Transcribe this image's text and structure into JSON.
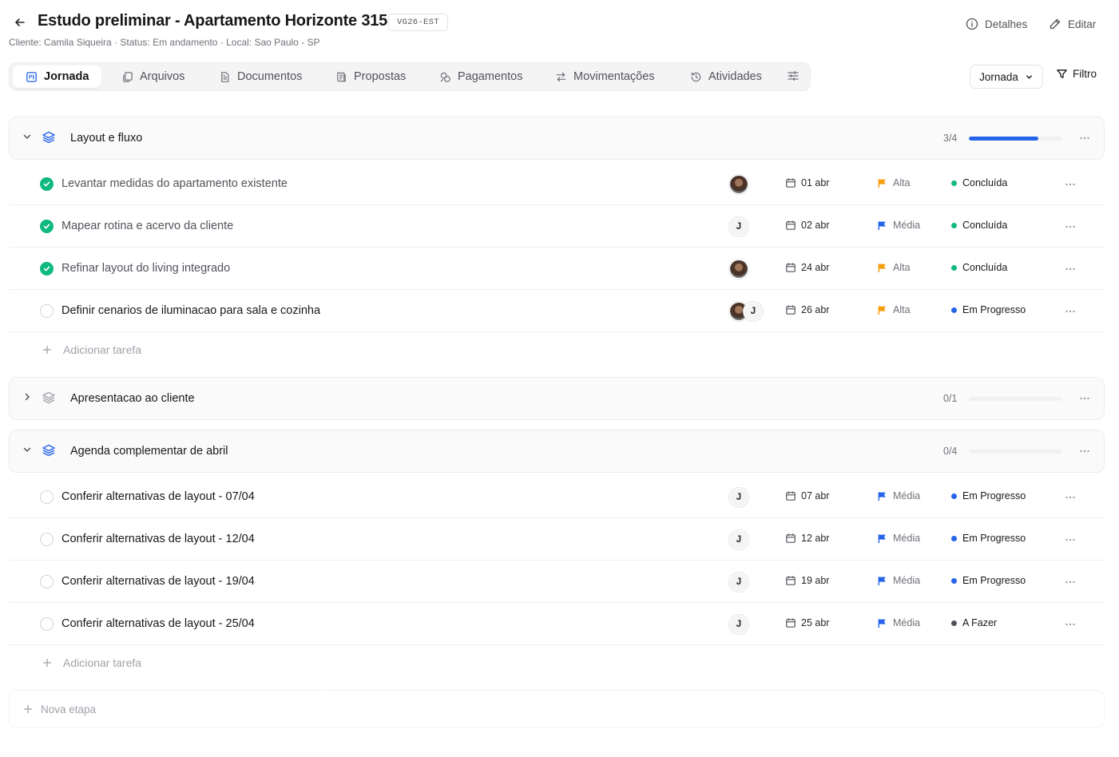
{
  "header": {
    "title": "Estudo preliminar - Apartamento Horizonte 315",
    "code": "VG26-EST",
    "subtitle": "Cliente: Camila Siqueira · Status: Em andamento · Local: Sao Paulo - SP",
    "details_label": "Detalhes",
    "edit_label": "Editar"
  },
  "tabs": [
    {
      "label": "Jornada",
      "icon": "kanban-icon",
      "active": true
    },
    {
      "label": "Arquivos",
      "icon": "files-icon"
    },
    {
      "label": "Documentos",
      "icon": "document-icon"
    },
    {
      "label": "Propostas",
      "icon": "proposal-icon"
    },
    {
      "label": "Pagamentos",
      "icon": "payments-icon"
    },
    {
      "label": "Movimentações",
      "icon": "arrows-exchange-icon"
    },
    {
      "label": "Atividades",
      "icon": "history-icon"
    }
  ],
  "toolbar": {
    "view_label": "Jornada",
    "filter_label": "Filtro"
  },
  "colors": {
    "accent": "#2563eb",
    "done": "#10b981",
    "priority_high": "#f59e0b",
    "priority_medium": "#2563eb",
    "status_done": "#10b981",
    "status_progress": "#2563eb",
    "status_todo": "#52525b"
  },
  "stages": [
    {
      "title": "Layout e fluxo",
      "count": "3/4",
      "progress": 0.75,
      "expanded": true,
      "tasks": [
        {
          "title": "Levantar medidas do apartamento existente",
          "done": true,
          "assignees": [
            "photo"
          ],
          "date": "01 abr",
          "priority": "Alta",
          "status": "Concluída"
        },
        {
          "title": "Mapear rotina e acervo da cliente",
          "done": true,
          "assignees": [
            "J"
          ],
          "date": "02 abr",
          "priority": "Média",
          "status": "Concluída"
        },
        {
          "title": "Refinar layout do living integrado",
          "done": true,
          "assignees": [
            "photo"
          ],
          "date": "24 abr",
          "priority": "Alta",
          "status": "Concluída"
        },
        {
          "title": "Definir cenarios de iluminacao para sala e cozinha",
          "done": false,
          "assignees": [
            "photo",
            "J"
          ],
          "date": "26 abr",
          "priority": "Alta",
          "status": "Em Progresso"
        }
      ],
      "add_label": "Adicionar tarefa"
    },
    {
      "title": "Apresentacao ao cliente",
      "count": "0/1",
      "progress": 0,
      "expanded": false
    },
    {
      "title": "Agenda complementar de abril",
      "count": "0/4",
      "progress": 0,
      "expanded": true,
      "tasks": [
        {
          "title": "Conferir alternativas de layout - 07/04",
          "done": false,
          "assignees": [
            "J"
          ],
          "date": "07 abr",
          "priority": "Média",
          "status": "Em Progresso"
        },
        {
          "title": "Conferir alternativas de layout - 12/04",
          "done": false,
          "assignees": [
            "J"
          ],
          "date": "12 abr",
          "priority": "Média",
          "status": "Em Progresso"
        },
        {
          "title": "Conferir alternativas de layout - 19/04",
          "done": false,
          "assignees": [
            "J"
          ],
          "date": "19 abr",
          "priority": "Média",
          "status": "Em Progresso"
        },
        {
          "title": "Conferir alternativas de layout - 25/04",
          "done": false,
          "assignees": [
            "J"
          ],
          "date": "25 abr",
          "priority": "Média",
          "status": "A Fazer"
        }
      ],
      "add_label": "Adicionar tarefa"
    }
  ],
  "new_stage_label": "Nova etapa"
}
